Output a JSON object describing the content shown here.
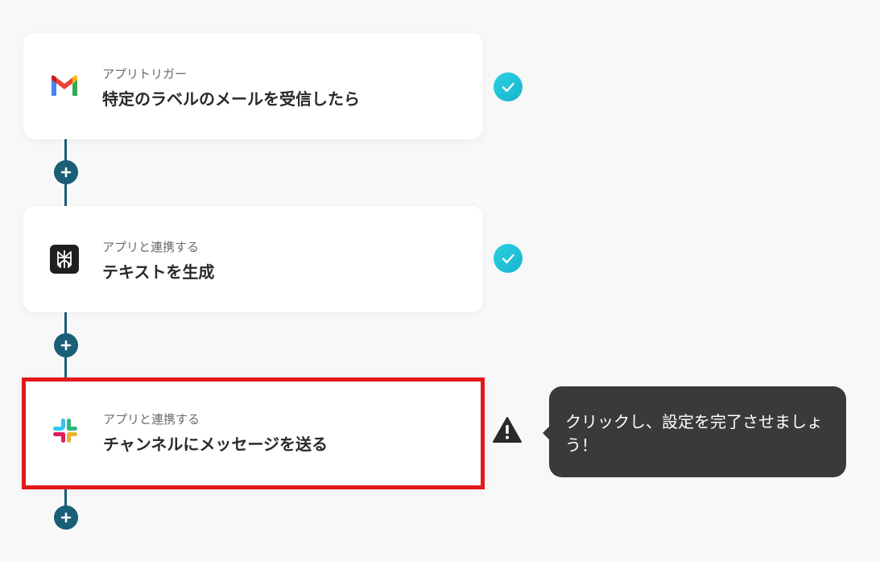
{
  "flow": {
    "steps": [
      {
        "subtitle": "アプリトリガー",
        "title": "特定のラベルのメールを受信したら",
        "icon": "gmail-icon",
        "status": "complete"
      },
      {
        "subtitle": "アプリと連携する",
        "title": "テキストを生成",
        "icon": "perplexity-icon",
        "status": "complete"
      },
      {
        "subtitle": "アプリと連携する",
        "title": "チャンネルにメッセージを送る",
        "icon": "slack-icon",
        "status": "warning"
      }
    ],
    "tooltip": "クリックし、設定を完了させましょう！"
  },
  "colors": {
    "connector": "#1a5e78",
    "check": "#22c5d8",
    "highlight_border": "#e4191c",
    "tooltip_bg": "#3a3a3a"
  }
}
